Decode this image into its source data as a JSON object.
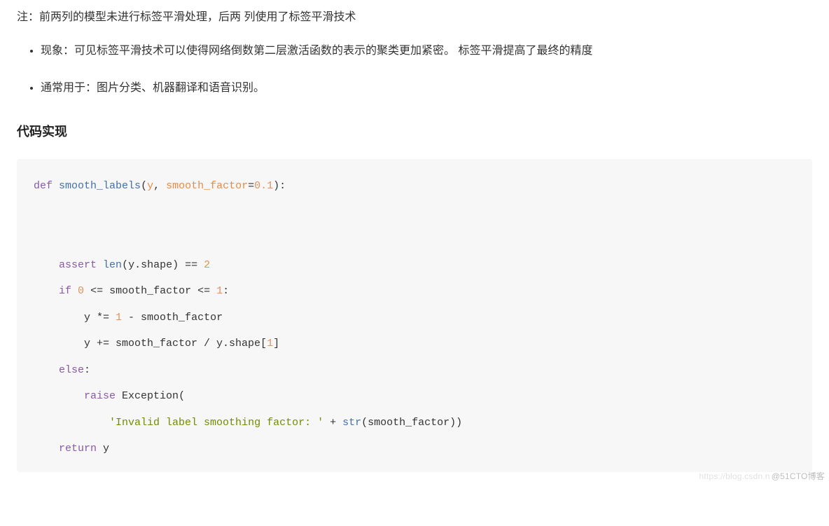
{
  "note": "注：前两列的模型未进行标签平滑处理，后两 列使用了标签平滑技术",
  "bullets": [
    "现象：可见标签平滑技术可以使得网络倒数第二层激活函数的表示的聚类更加紧密。 标签平滑提高了最终的精度",
    "通常用于：图片分类、机器翻译和语音识别。"
  ],
  "heading": "代码实现",
  "code": {
    "def": "def",
    "fn_name": "smooth_labels",
    "lparen": "(",
    "param_y": "y",
    "comma": ", ",
    "param_sf": "smooth_factor",
    "eq": "=",
    "default": "0.1",
    "rparen_colon": "):",
    "assert_kw": "assert",
    "len_fn": "len",
    "assert_expr_mid": "(y.shape) == ",
    "two": "2",
    "if_kw": "if",
    "zero": "0",
    "if_mid": " <= smooth_factor <= ",
    "one": "1",
    "if_end": ":",
    "mul_line_pre": "        y *= ",
    "mul_one": "1",
    "mul_line_post": " - smooth_factor",
    "add_line_pre": "        y += smooth_factor / y.shape[",
    "idx_one": "1",
    "add_line_post": "]",
    "else_kw": "else",
    "else_colon": ":",
    "raise_kw": "raise",
    "exception": "Exception",
    "exc_open": "(",
    "exc_str": "'Invalid label smoothing factor: '",
    "exc_plus": " + ",
    "str_fn": "str",
    "exc_tail": "(smooth_factor))",
    "return_kw": "return",
    "return_val": " y"
  },
  "watermark": {
    "faint": "https://blog.csdn.n",
    "main": "@51CTO博客"
  }
}
